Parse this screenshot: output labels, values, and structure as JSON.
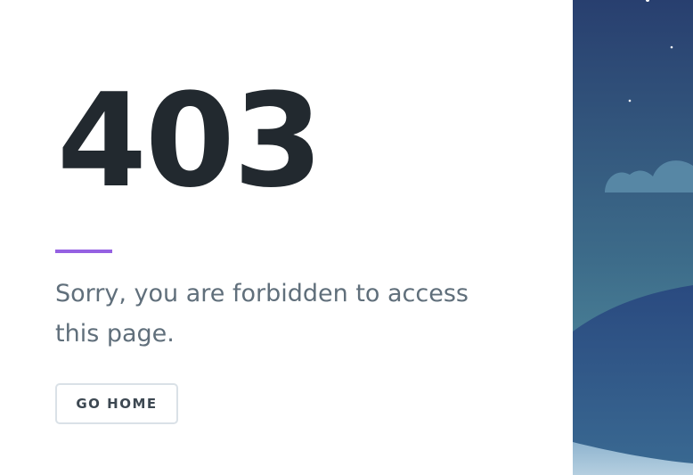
{
  "error": {
    "code": "403",
    "message": "Sorry, you are forbidden to access this page."
  },
  "actions": {
    "home_label": "GO HOME"
  },
  "colors": {
    "heading": "#22292f",
    "accent": "#9561e2",
    "text": "#606f7b",
    "button_border": "#dae1e7",
    "sky_top": "#2a4777",
    "sky_bottom": "#4d8a9c"
  },
  "illustration": {
    "icons": [
      "star-icon",
      "cloud-icon",
      "hill-icon"
    ]
  }
}
